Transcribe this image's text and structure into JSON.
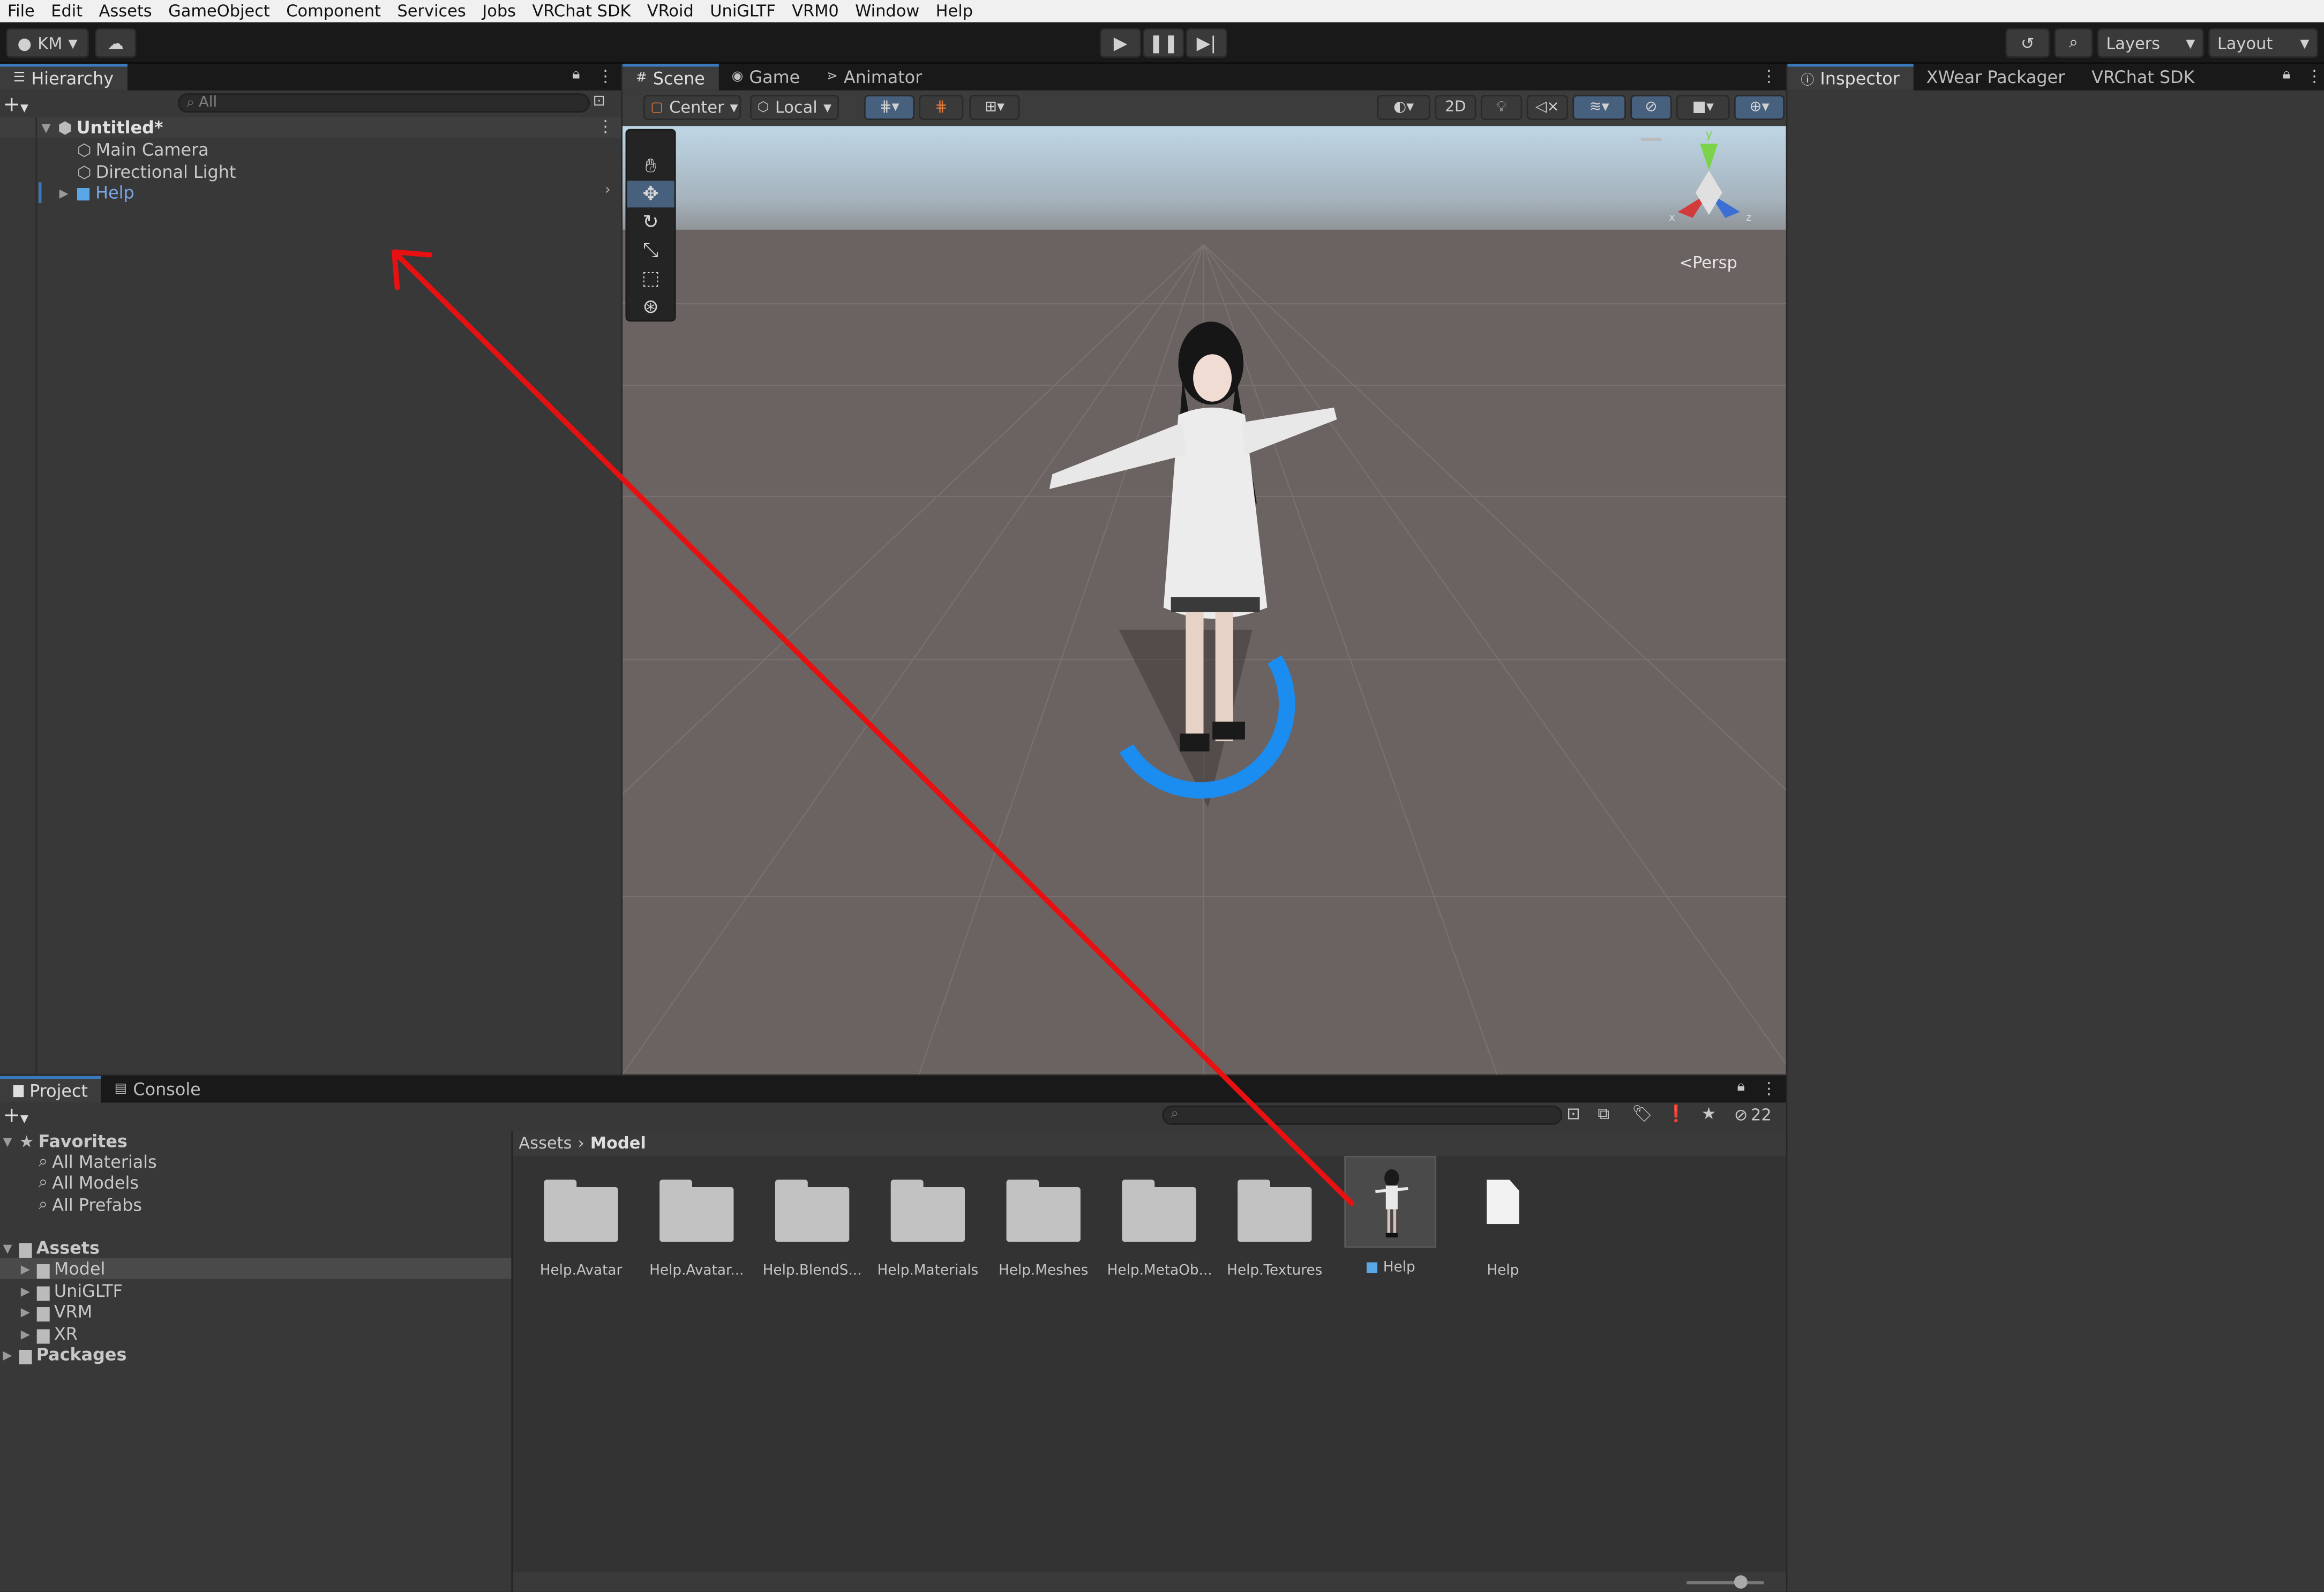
{
  "menu": [
    "File",
    "Edit",
    "Assets",
    "GameObject",
    "Component",
    "Services",
    "Jobs",
    "VRChat SDK",
    "VRoid",
    "UniGLTF",
    "VRM0",
    "Window",
    "Help"
  ],
  "toolbar": {
    "account": "KM",
    "layers": "Layers",
    "layout": "Layout"
  },
  "hierarchy": {
    "tab": "Hierarchy",
    "search_placeholder": "All",
    "scene": "Untitled*",
    "items": [
      "Main Camera",
      "Directional Light",
      "Help"
    ]
  },
  "scene_tabs": [
    "Scene",
    "Game",
    "Animator"
  ],
  "scene_toolbar": {
    "pivot": "Center",
    "space": "Local",
    "mode_2d": "2D"
  },
  "gizmo": {
    "y": "y",
    "x": "x",
    "z": "z",
    "projection": "Persp"
  },
  "inspector_tabs": [
    "Inspector",
    "XWear Packager",
    "VRChat SDK"
  ],
  "project": {
    "tabs": [
      "Project",
      "Console"
    ],
    "hidden_count": "22",
    "favorites": {
      "label": "Favorites",
      "items": [
        "All Materials",
        "All Models",
        "All Prefabs"
      ]
    },
    "assets": {
      "label": "Assets",
      "items": [
        "Model",
        "UniGLTF",
        "VRM",
        "XR"
      ]
    },
    "packages": "Packages",
    "breadcrumb": [
      "Assets",
      "Model"
    ],
    "grid": [
      "Help.Avatar",
      "Help.Avatar...",
      "Help.BlendS...",
      "Help.Materials",
      "Help.Meshes",
      "Help.MetaOb...",
      "Help.Textures",
      "Help",
      "Help"
    ]
  },
  "colors": {
    "accent": "#3a79bb",
    "arrow": "#e81010",
    "selected_text": "#7aa6e4"
  }
}
